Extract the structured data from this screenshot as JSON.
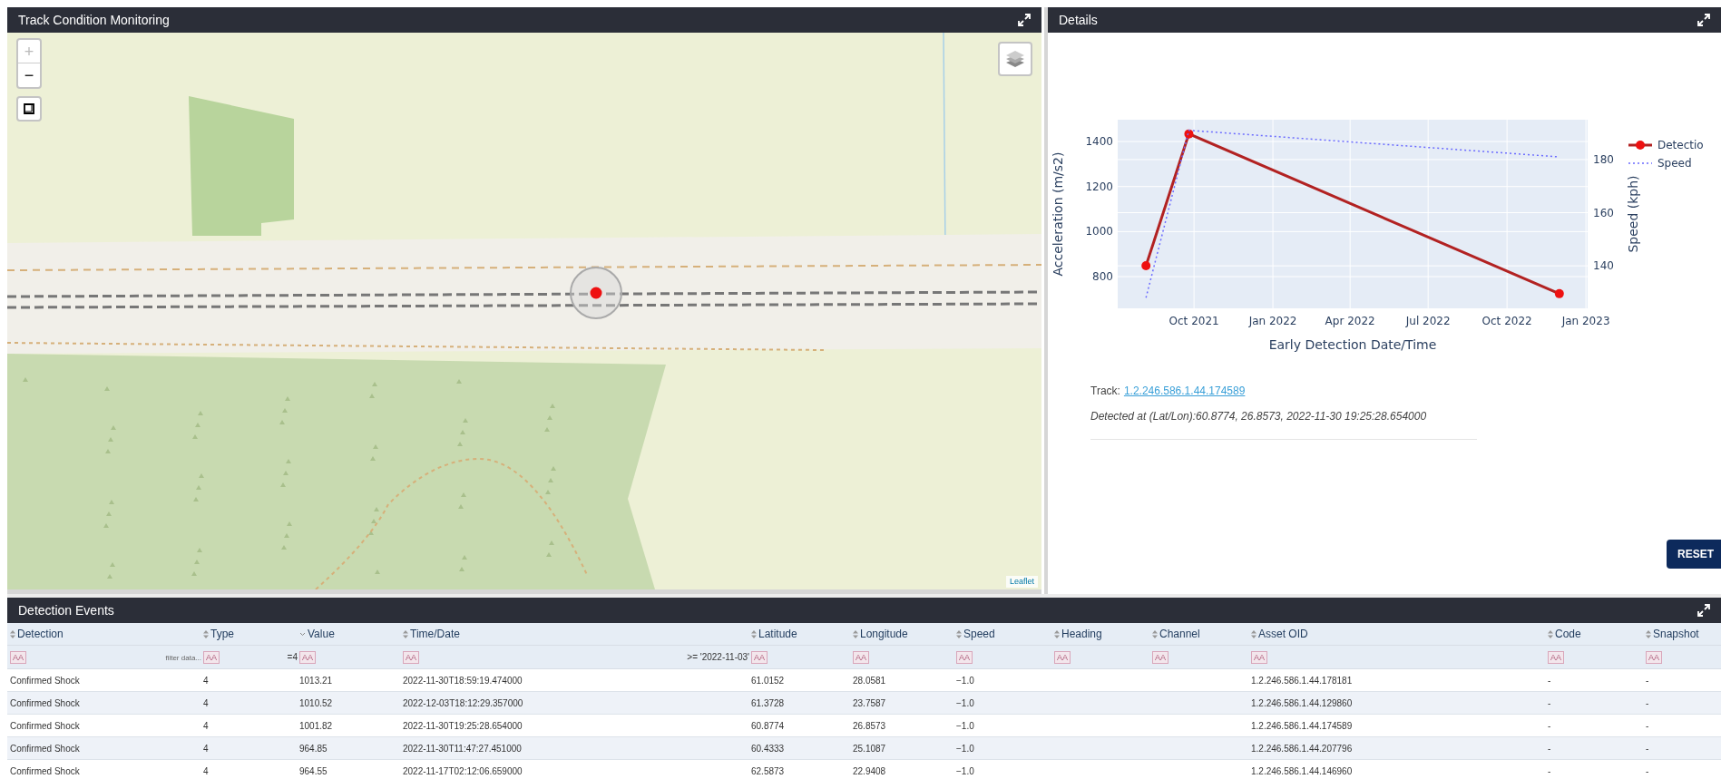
{
  "map_panel": {
    "title": "Track Condition Monitoring",
    "zoom_in": "+",
    "zoom_out": "−",
    "attribution": "Leaflet"
  },
  "details_panel": {
    "title": "Details",
    "chart_data": {
      "type": "line",
      "grid": true,
      "legend": "right",
      "xlabel": "Early Detection Date/Time",
      "ylabel": "Acceleration (m/s2)",
      "y2label": "Speed (kph)",
      "x": [
        "2021-08-06",
        "2021-09-25",
        "2022-12-01"
      ],
      "xlim": [
        "2021-07-04",
        "2023-01-03"
      ],
      "xticks": [
        {
          "value": "2021-10-01",
          "label": "Oct 2021"
        },
        {
          "value": "2022-01-01",
          "label": "Jan 2022"
        },
        {
          "value": "2022-04-01",
          "label": "Apr 2022"
        },
        {
          "value": "2022-07-01",
          "label": "Jul 2022"
        },
        {
          "value": "2022-10-01",
          "label": "Oct 2022"
        },
        {
          "value": "2023-01-01",
          "label": "Jan 2023"
        }
      ],
      "ylim": [
        659,
        1497
      ],
      "yticks": [
        800,
        1000,
        1200,
        1400
      ],
      "y2lim": [
        124,
        195
      ],
      "y2ticks": [
        140,
        160,
        180
      ],
      "series": [
        {
          "name": "Detectio",
          "color": "#b22222",
          "marker": "circle",
          "values": [
            848,
            1434,
            724
          ]
        },
        {
          "name": "Speed",
          "color": "#6b6bff",
          "axis": "y2",
          "line_style": "dotted",
          "values": [
            128,
            191,
            181
          ]
        }
      ]
    },
    "track_label": "Track:",
    "track_link": "1.2.246.586.1.44.174589",
    "detected_text": "Detected at (Lat/Lon):60.8774, 26.8573, 2022-11-30 19:25:28.654000",
    "reset_button": "RESET"
  },
  "events_panel": {
    "title": "Detection Events",
    "columns": [
      {
        "label": "Detection",
        "sorted": false,
        "case_toggle": "AA",
        "filter_placeholder": "filter data..."
      },
      {
        "label": "Type",
        "sorted": false,
        "case_toggle": "AA",
        "filter_value": "=4"
      },
      {
        "label": "Value",
        "sorted": true,
        "case_toggle": "AA"
      },
      {
        "label": "Time/Date",
        "sorted": false,
        "case_toggle": "AA",
        "filter_value": ">= '2022-11-03'"
      },
      {
        "label": "Latitude",
        "sorted": false,
        "case_toggle": "AA"
      },
      {
        "label": "Longitude",
        "sorted": false,
        "case_toggle": "AA"
      },
      {
        "label": "Speed",
        "sorted": false,
        "case_toggle": "AA"
      },
      {
        "label": "Heading",
        "sorted": false,
        "case_toggle": "AA"
      },
      {
        "label": "Channel",
        "sorted": false,
        "case_toggle": "AA"
      },
      {
        "label": "Asset OID",
        "sorted": false,
        "case_toggle": "AA"
      },
      {
        "label": "Code",
        "sorted": false,
        "case_toggle": "AA"
      },
      {
        "label": "Snapshot",
        "sorted": false,
        "case_toggle": "AA"
      }
    ],
    "rows": [
      {
        "detection": "Confirmed Shock",
        "type": "4",
        "value": "1013.21",
        "time_date": "2022-11-30T18:59:19.474000",
        "latitude": "61.0152",
        "longitude": "28.0581",
        "speed": "−1.0",
        "asset_oid": "1.2.246.586.1.44.178181",
        "code": "-",
        "snapshot": "-"
      },
      {
        "detection": "Confirmed Shock",
        "type": "4",
        "value": "1010.52",
        "time_date": "2022-12-03T18:12:29.357000",
        "latitude": "61.3728",
        "longitude": "23.7587",
        "speed": "−1.0",
        "asset_oid": "1.2.246.586.1.44.129860",
        "code": "-",
        "snapshot": "-"
      },
      {
        "detection": "Confirmed Shock",
        "type": "4",
        "value": "1001.82",
        "time_date": "2022-11-30T19:25:28.654000",
        "latitude": "60.8774",
        "longitude": "26.8573",
        "speed": "−1.0",
        "asset_oid": "1.2.246.586.1.44.174589",
        "code": "-",
        "snapshot": "-"
      },
      {
        "detection": "Confirmed Shock",
        "type": "4",
        "value": "964.85",
        "time_date": "2022-11-30T11:47:27.451000",
        "latitude": "60.4333",
        "longitude": "25.1087",
        "speed": "−1.0",
        "asset_oid": "1.2.246.586.1.44.207796",
        "code": "-",
        "snapshot": "-"
      },
      {
        "detection": "Confirmed Shock",
        "type": "4",
        "value": "964.55",
        "time_date": "2022-11-17T02:12:06.659000",
        "latitude": "62.5873",
        "longitude": "22.9408",
        "speed": "−1.0",
        "asset_oid": "1.2.246.586.1.44.146960",
        "code": "-",
        "snapshot": "-"
      }
    ]
  }
}
